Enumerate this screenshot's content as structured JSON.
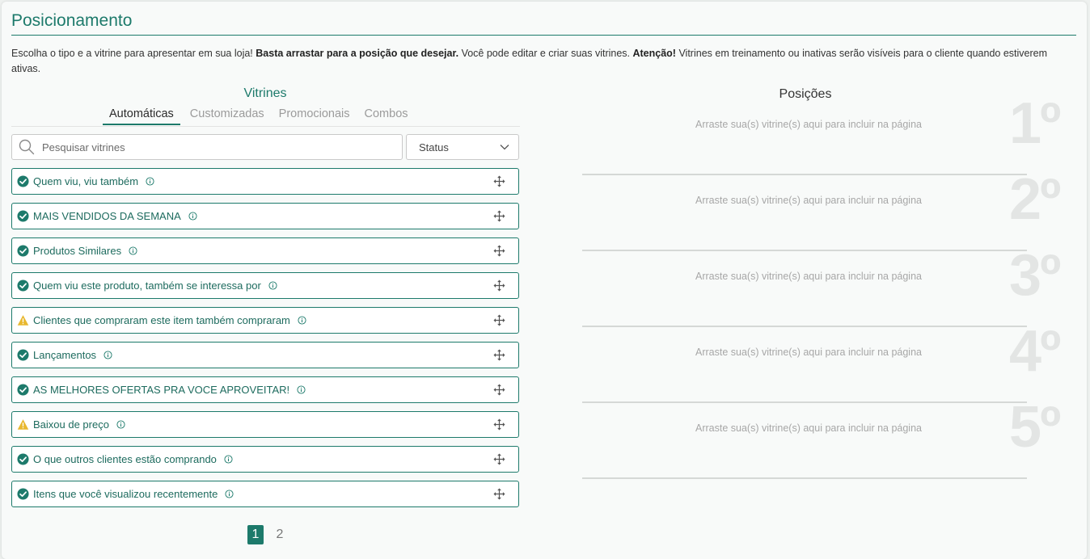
{
  "page": {
    "title": "Posicionamento",
    "description_1": "Escolha o tipo e a vitrine para apresentar em sua loja! ",
    "description_2": "Basta arrastar para a posição que desejar.",
    "description_3": " Você pode editar e criar suas vitrines. ",
    "description_4": "Atenção!",
    "description_5": " Vitrines em treinamento ou inativas serão visíveis para o cliente quando estiverem ativas."
  },
  "vitrines": {
    "heading": "Vitrines",
    "tabs": [
      "Automáticas",
      "Customizadas",
      "Promocionais",
      "Combos"
    ],
    "active_tab": "Automáticas",
    "search_placeholder": "Pesquisar vitrines",
    "status_label": "Status",
    "items": [
      {
        "label": "Quem viu, viu também",
        "status": "check"
      },
      {
        "label": "MAIS VENDIDOS DA SEMANA",
        "status": "check"
      },
      {
        "label": "Produtos Similares",
        "status": "check"
      },
      {
        "label": "Quem viu este produto, também se interessa por",
        "status": "check"
      },
      {
        "label": "Clientes que compraram este item também compraram",
        "status": "warning"
      },
      {
        "label": "Lançamentos",
        "status": "check"
      },
      {
        "label": "AS MELHORES OFERTAS PRA VOCE APROVEITAR!",
        "status": "check"
      },
      {
        "label": "Baixou de preço",
        "status": "warning"
      },
      {
        "label": "O que outros clientes estão comprando",
        "status": "check"
      },
      {
        "label": "Itens que você visualizou recentemente",
        "status": "check"
      }
    ],
    "pages": [
      "1",
      "2"
    ],
    "current_page": "1"
  },
  "posicoes": {
    "heading": "Posições",
    "slots": [
      {
        "number": "1º",
        "hint": "Arraste sua(s) vitrine(s) aqui para incluir na página"
      },
      {
        "number": "2º",
        "hint": "Arraste sua(s) vitrine(s) aqui para incluir na página"
      },
      {
        "number": "3º",
        "hint": "Arraste sua(s) vitrine(s) aqui para incluir na página"
      },
      {
        "number": "4º",
        "hint": "Arraste sua(s) vitrine(s) aqui para incluir na página"
      },
      {
        "number": "5º",
        "hint": "Arraste sua(s) vitrine(s) aqui para incluir na página"
      }
    ]
  },
  "colors": {
    "accent": "#1d7a6b",
    "check": "#1d7a6b",
    "warning": "#e8b830",
    "muted_number": "#e3e5e4"
  },
  "icons": {
    "search": "search-icon",
    "check": "check-circle-icon",
    "warning": "warning-triangle-icon",
    "info": "info-icon",
    "move": "move-arrows-icon",
    "chevron": "chevron-down-icon"
  }
}
